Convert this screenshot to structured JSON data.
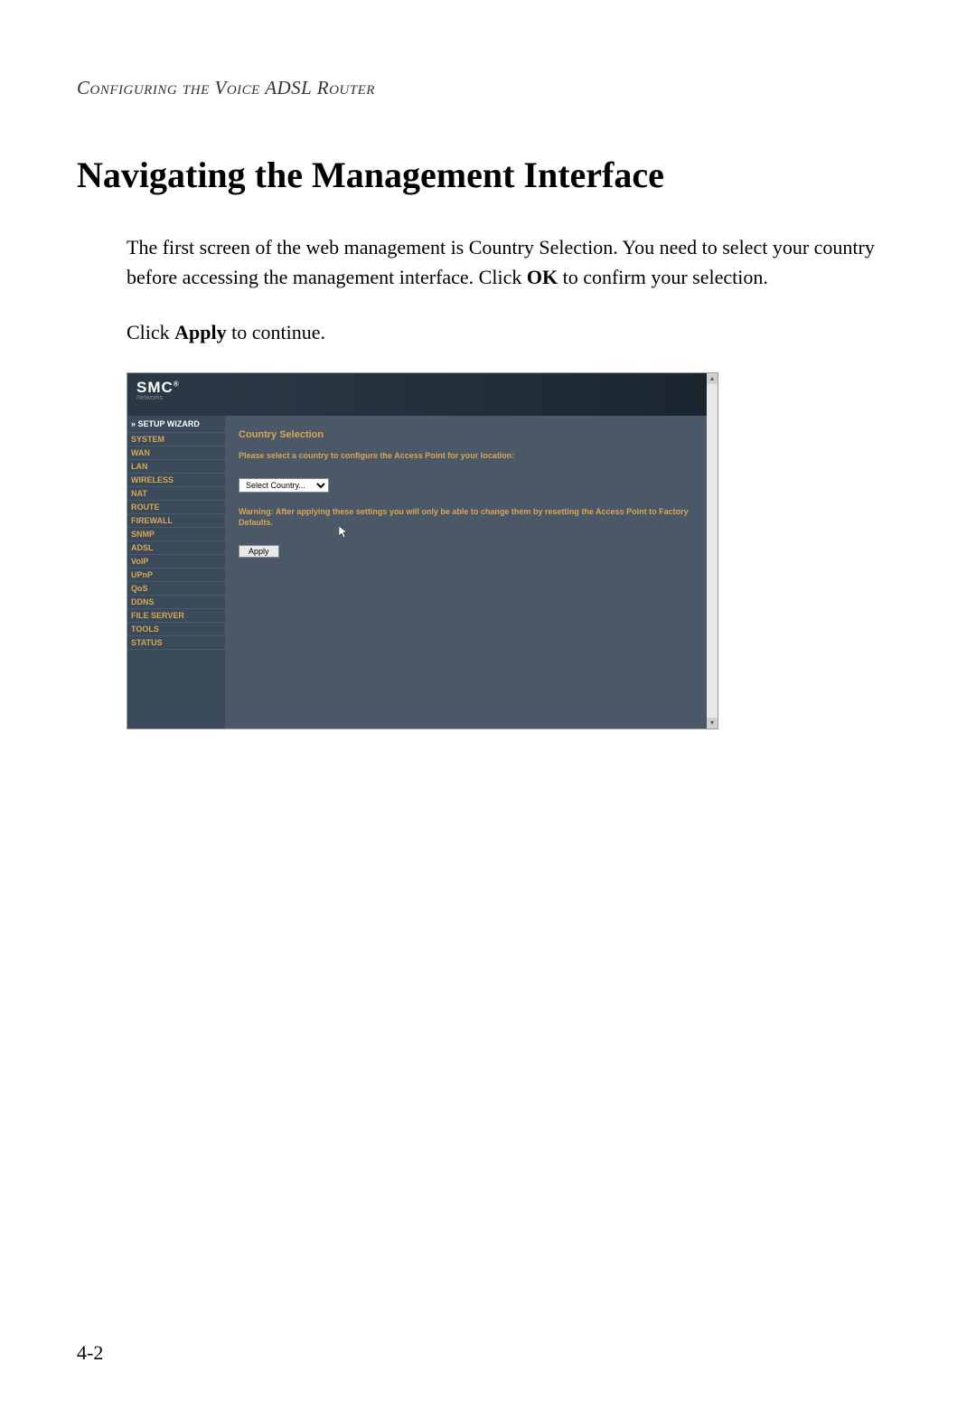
{
  "page_header": "Configuring the Voice ADSL Router",
  "section_title": "Navigating the Management Interface",
  "paragraph1_part1": "The first screen of the web management is Country Selection. You need to select your country before accessing the management interface. Click ",
  "paragraph1_bold1": "OK",
  "paragraph1_part2": " to confirm your selection.",
  "paragraph2_part1": "Click ",
  "paragraph2_bold1": "Apply",
  "paragraph2_part2": " to continue.",
  "page_number": "4-2",
  "screenshot": {
    "logo": {
      "main": "SMC",
      "reg": "®",
      "sub": "Networks"
    },
    "sidebar": {
      "items": [
        "» SETUP WIZARD",
        "SYSTEM",
        "WAN",
        "LAN",
        "WIRELESS",
        "NAT",
        "ROUTE",
        "FIREWALL",
        "SNMP",
        "ADSL",
        "VoIP",
        "UPnP",
        "QoS",
        "DDNS",
        "FILE SERVER",
        "TOOLS",
        "STATUS"
      ]
    },
    "content": {
      "title": "Country Selection",
      "instruction": "Please select a country to configure the Access Point for your location:",
      "select_value": "Select Country...",
      "warning": "Warning: After applying these settings you will only be able to change them by resetting the Access Point to Factory Defaults.",
      "apply_label": "Apply"
    }
  }
}
